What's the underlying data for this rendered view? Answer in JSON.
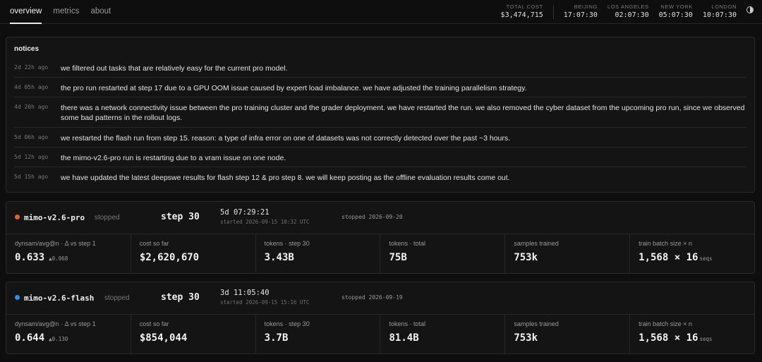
{
  "tabs": [
    {
      "label": "overview",
      "active": true
    },
    {
      "label": "metrics",
      "active": false
    },
    {
      "label": "about",
      "active": false
    }
  ],
  "total_cost": {
    "label": "TOTAL COST",
    "value": "$3,474,715"
  },
  "clocks": [
    {
      "city": "BEIJING",
      "time": "17:07:30"
    },
    {
      "city": "LOS ANGELES",
      "time": "02:07:30"
    },
    {
      "city": "NEW YORK",
      "time": "05:07:30"
    },
    {
      "city": "LONDON",
      "time": "10:07:30"
    }
  ],
  "theme_toggle_icon": "half-circle-icon",
  "notices": {
    "title": "notices",
    "items": [
      {
        "age": "2d 22h ago",
        "text": "we filtered out tasks that are relatively easy for the current pro model."
      },
      {
        "age": "4d 05h ago",
        "text": "the pro run restarted at step 17 due to a GPU OOM issue caused by expert load imbalance. we have adjusted the training parallelism strategy."
      },
      {
        "age": "4d 20h ago",
        "text": "there was a network connectivity issue between the pro training cluster and the grader deployment. we have restarted the run. we also removed the cyber dataset from the upcoming pro run, since we observed some bad patterns in the rollout logs."
      },
      {
        "age": "5d 06h ago",
        "text": "we restarted the flash run from step 15. reason: a type of infra error on one of datasets was not correctly detected over the past ~3 hours."
      },
      {
        "age": "5d 12h ago",
        "text": "the mimo-v2.6-pro run is restarting due to a vram issue on one node."
      },
      {
        "age": "5d 15h ago",
        "text": "we have updated the latest deepswe results for flash step 12 & pro step 8. we will keep posting as the offline evaluation results come out."
      }
    ]
  },
  "runs": [
    {
      "name": "mimo-v2.6-pro",
      "dot_color": "#e0612f",
      "status": "stopped",
      "step": "step 30",
      "duration": "5d 07:29:21",
      "started": "started 2026-09-15 10:32 UTC",
      "stopped": "stopped 2026-09-20",
      "stats": {
        "dynsam": {
          "label": "dynsam/avg@n · Δ vs step 1",
          "value": "0.633",
          "delta": "▲0.068"
        },
        "cost": {
          "label": "cost so far",
          "value": "$2,620,670"
        },
        "tokens_step": {
          "label": "tokens · step 30",
          "value": "3.43B"
        },
        "tokens_total": {
          "label": "tokens · total",
          "value": "75B"
        },
        "samples": {
          "label": "samples trained",
          "value": "753k"
        },
        "batch": {
          "label": "train batch size × n",
          "value": "1,568 × 16",
          "suffix": "seqs"
        }
      }
    },
    {
      "name": "mimo-v2.6-flash",
      "dot_color": "#3b8ae6",
      "status": "stopped",
      "step": "step 30",
      "duration": "3d 11:05:40",
      "started": "started 2026-09-15 15:16 UTC",
      "stopped": "stopped 2026-09-19",
      "stats": {
        "dynsam": {
          "label": "dynsam/avg@n · Δ vs step 1",
          "value": "0.644",
          "delta": "▲0.130"
        },
        "cost": {
          "label": "cost so far",
          "value": "$854,044"
        },
        "tokens_step": {
          "label": "tokens · step 30",
          "value": "3.7B"
        },
        "tokens_total": {
          "label": "tokens · total",
          "value": "81.4B"
        },
        "samples": {
          "label": "samples trained",
          "value": "753k"
        },
        "batch": {
          "label": "train batch size × n",
          "value": "1,568 × 16",
          "suffix": "seqs"
        }
      }
    }
  ]
}
